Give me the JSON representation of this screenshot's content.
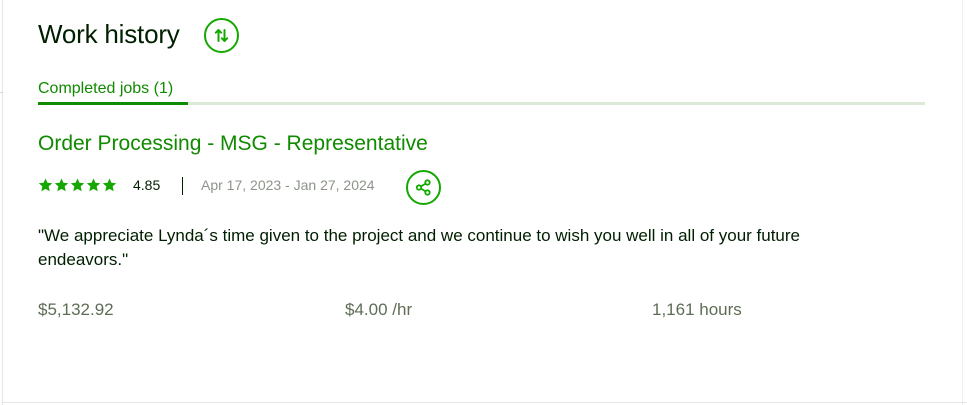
{
  "section": {
    "title": "Work history",
    "sort_icon": "sort-up-down-icon"
  },
  "tabs": [
    {
      "label": "Completed jobs (1)",
      "active": true
    }
  ],
  "job": {
    "title": "Order Processing - MSG - Representative",
    "rating": "4.85",
    "stars": 5,
    "dates": "Apr 17, 2023 - Jan 27, 2024",
    "share_icon": "share-icon",
    "feedback": "\"We appreciate Lynda´s time given to the project and we continue to wish you well in all of your future endeavors.\"",
    "earned": "$5,132.92",
    "rate": "$4.00 /hr",
    "hours": "1,161 hours"
  },
  "colors": {
    "brand_green": "#14a800",
    "link_green": "#108a00",
    "text_dark": "#001e00",
    "text_muted": "#5e6d55",
    "date_gray": "#8d958a"
  }
}
